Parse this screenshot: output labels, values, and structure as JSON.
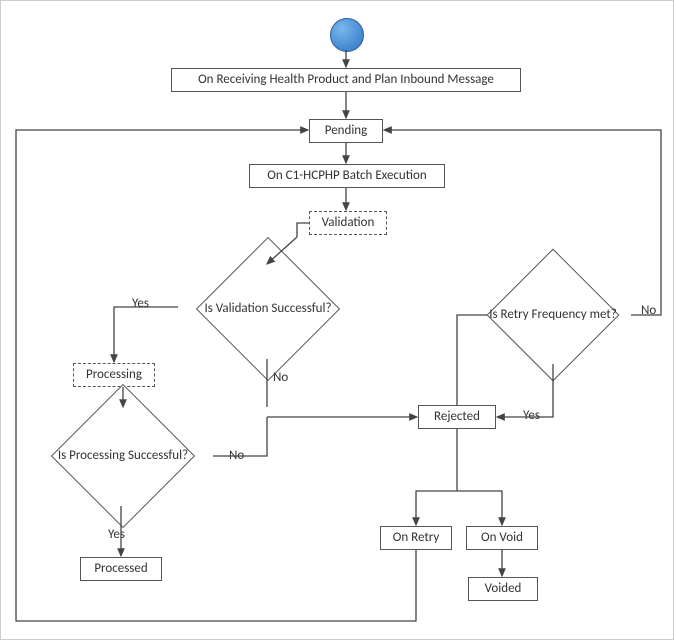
{
  "diagram": {
    "title_box": "On Receiving Health Product and Plan Inbound Message",
    "pending": "Pending",
    "batch_exec": "On C1-HCPHP Batch Execution",
    "validation": "Validation",
    "is_validation": "Is Validation Successful?",
    "processing": "Processing",
    "is_processing": "Is Processing Successful?",
    "processed": "Processed",
    "rejected": "Rejected",
    "is_retry": "Is Retry Frequency met?",
    "on_retry": "On Retry",
    "on_void": "On Void",
    "voided": "Voided",
    "labels": {
      "yes1": "Yes",
      "no1": "No",
      "no2": "No",
      "yes2": "Yes",
      "yes3": "Yes",
      "no3": "No"
    }
  },
  "chart_data": {
    "type": "flowchart",
    "nodes": [
      {
        "id": "start",
        "type": "start",
        "label": ""
      },
      {
        "id": "title",
        "type": "process",
        "label": "On Receiving Health Product and Plan Inbound Message"
      },
      {
        "id": "pending",
        "type": "process",
        "label": "Pending"
      },
      {
        "id": "batch",
        "type": "process",
        "label": "On C1-HCPHP Batch Execution"
      },
      {
        "id": "validation",
        "type": "sub",
        "label": "Validation"
      },
      {
        "id": "d_validation",
        "type": "decision",
        "label": "Is Validation Successful?"
      },
      {
        "id": "processing",
        "type": "sub",
        "label": "Processing"
      },
      {
        "id": "d_processing",
        "type": "decision",
        "label": "Is Processing Successful?"
      },
      {
        "id": "processed",
        "type": "terminal",
        "label": "Processed"
      },
      {
        "id": "rejected",
        "type": "process",
        "label": "Rejected"
      },
      {
        "id": "d_retry",
        "type": "decision",
        "label": "Is Retry Frequency met?"
      },
      {
        "id": "on_retry",
        "type": "process",
        "label": "On Retry"
      },
      {
        "id": "on_void",
        "type": "process",
        "label": "On Void"
      },
      {
        "id": "voided",
        "type": "terminal",
        "label": "Voided"
      }
    ],
    "edges": [
      {
        "from": "start",
        "to": "title"
      },
      {
        "from": "title",
        "to": "pending"
      },
      {
        "from": "pending",
        "to": "batch"
      },
      {
        "from": "batch",
        "to": "validation"
      },
      {
        "from": "validation",
        "to": "d_validation"
      },
      {
        "from": "d_validation",
        "to": "processing",
        "label": "Yes"
      },
      {
        "from": "d_validation",
        "to": "rejected",
        "label": "No"
      },
      {
        "from": "processing",
        "to": "d_processing"
      },
      {
        "from": "d_processing",
        "to": "processed",
        "label": "Yes"
      },
      {
        "from": "d_processing",
        "to": "rejected",
        "label": "No"
      },
      {
        "from": "rejected",
        "to": "d_retry"
      },
      {
        "from": "d_retry",
        "to": "rejected",
        "label": "Yes"
      },
      {
        "from": "d_retry",
        "to": "pending",
        "label": "No"
      },
      {
        "from": "rejected",
        "to": "on_retry"
      },
      {
        "from": "rejected",
        "to": "on_void"
      },
      {
        "from": "on_void",
        "to": "voided"
      },
      {
        "from": "on_retry",
        "to": "pending"
      }
    ]
  }
}
